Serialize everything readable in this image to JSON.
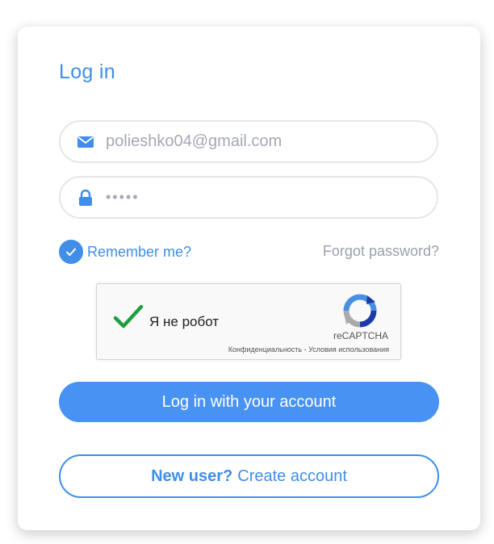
{
  "form": {
    "title": "Log in",
    "email": {
      "value": "polieshko04@gmail.com",
      "icon": "envelope-icon"
    },
    "password": {
      "value": "•••••",
      "icon": "lock-icon"
    },
    "remember": {
      "label": "Remember me?",
      "checked": true
    },
    "forgot_label": "Forgot password?",
    "login_button": "Log in with your account",
    "new_user": {
      "prefix": "New user?",
      "action": "Create account"
    }
  },
  "captcha": {
    "label": "Я не робот",
    "brand": "reCAPTCHA",
    "legal": "Конфиденциальность - Условия использования",
    "checked": true
  },
  "colors": {
    "accent": "#3f8ee8",
    "button": "#4892f3",
    "muted": "#9aa0ad",
    "captcha_check": "#1e9e3e"
  }
}
